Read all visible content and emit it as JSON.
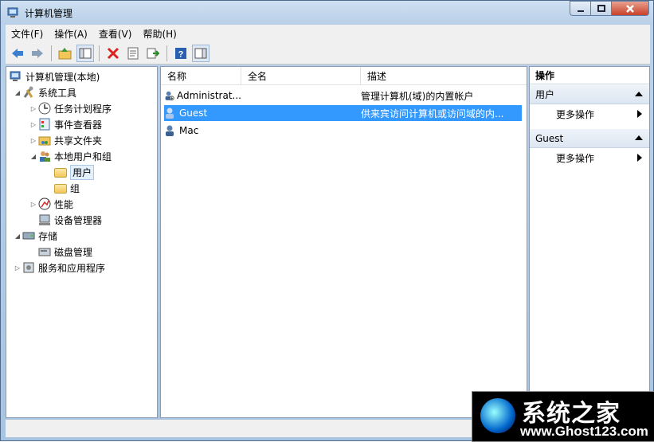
{
  "window": {
    "title": "计算机管理"
  },
  "menu": [
    "文件(F)",
    "操作(A)",
    "查看(V)",
    "帮助(H)"
  ],
  "toolbar_icons": [
    "back-arrow-icon",
    "forward-arrow-icon",
    "up-folder-icon",
    "show-hide-tree-icon",
    "delete-icon",
    "properties-icon",
    "export-icon",
    "help-icon",
    "show-action-pane-icon"
  ],
  "tree": {
    "root": "计算机管理(本地)",
    "system_tools": "系统工具",
    "task_scheduler": "任务计划程序",
    "event_viewer": "事件查看器",
    "shared_folders": "共享文件夹",
    "local_users_groups": "本地用户和组",
    "users": "用户",
    "groups": "组",
    "performance": "性能",
    "device_manager": "设备管理器",
    "storage": "存储",
    "disk_management": "磁盘管理",
    "services_apps": "服务和应用程序"
  },
  "list": {
    "columns": [
      "名称",
      "全名",
      "描述"
    ],
    "rows": [
      {
        "name": "Administrat...",
        "full": "",
        "desc": "管理计算机(域)的内置帐户"
      },
      {
        "name": "Guest",
        "full": "",
        "desc": "供来宾访问计算机或访问域的内..."
      },
      {
        "name": "Mac",
        "full": "",
        "desc": ""
      }
    ]
  },
  "actions": {
    "title": "操作",
    "section1": "用户",
    "section1_more": "更多操作",
    "section2": "Guest",
    "section2_more": "更多操作"
  },
  "watermark": {
    "title": "系统之家",
    "url": "www.Ghost123.com"
  },
  "colors": {
    "selection": "#3399ff",
    "window_frame": "#bcd3ea"
  }
}
